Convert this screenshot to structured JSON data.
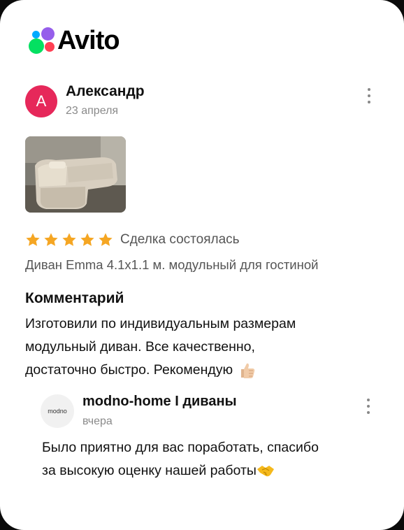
{
  "brand": {
    "name": "Avito"
  },
  "review": {
    "author_initial": "А",
    "author_name": "Александр",
    "date": "23 апреля",
    "stars": 5,
    "status": "Сделка состоялась",
    "product": "Диван Emma 4.1x1.1 м. модульный для гостиной",
    "comment_title": "Комментарий",
    "comment_lines": [
      "Изготовили по индивидуальным размерам",
      "модульный диван. Все качественно,",
      "достаточно быстро. Рекомендую"
    ],
    "comment_emoji": "thumbs-up"
  },
  "reply": {
    "avatar_text": "modno",
    "name": "modno-home I диваны",
    "date": "вчера",
    "lines": [
      "Было приятно для вас поработать, спасибо",
      "за высокую оценку нашей работы"
    ],
    "emoji": "handshake"
  },
  "colors": {
    "star": "#f5a623",
    "avatar": "#e6285a"
  }
}
